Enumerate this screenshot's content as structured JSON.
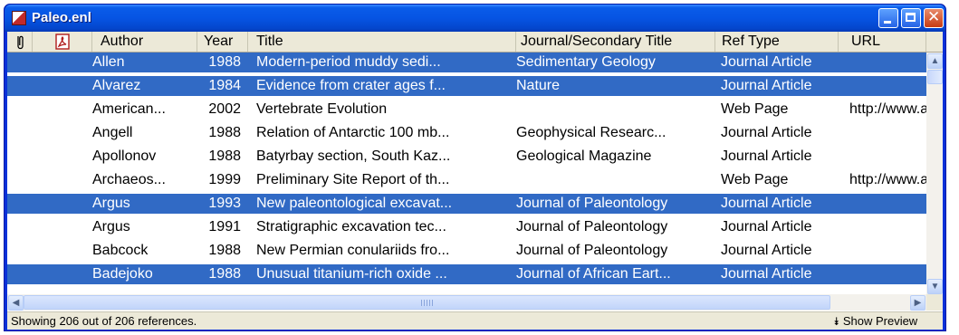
{
  "window": {
    "title": "Paleo.enl"
  },
  "columns": {
    "attachment_icon": "paperclip-icon",
    "pdf_icon": "pdf-icon",
    "author": "Author",
    "year": "Year",
    "title": "Title",
    "journal": "Journal/Secondary Title",
    "reftype": "Ref Type",
    "url": "URL"
  },
  "rows": [
    {
      "selected": true,
      "author": "Allen",
      "year": "1988",
      "title": "Modern-period muddy sedi...",
      "journal": "Sedimentary Geology",
      "reftype": "Journal Article",
      "url": ""
    },
    {
      "selected": true,
      "author": "Alvarez",
      "year": "1984",
      "title": "Evidence from crater ages f...",
      "journal": "Nature",
      "reftype": "Journal Article",
      "url": ""
    },
    {
      "selected": false,
      "author": "American...",
      "year": "2002",
      "title": "Vertebrate Evolution",
      "journal": "",
      "reftype": "Web Page",
      "url": "http://www.a"
    },
    {
      "selected": false,
      "author": "Angell",
      "year": "1988",
      "title": "Relation of Antarctic 100 mb...",
      "journal": "Geophysical Researc...",
      "reftype": "Journal Article",
      "url": ""
    },
    {
      "selected": false,
      "author": "Apollonov",
      "year": "1988",
      "title": "Batyrbay section, South Kaz...",
      "journal": "Geological Magazine",
      "reftype": "Journal Article",
      "url": ""
    },
    {
      "selected": false,
      "author": "Archaeos...",
      "year": "1999",
      "title": "Preliminary Site Report of th...",
      "journal": "",
      "reftype": "Web Page",
      "url": "http://www.a"
    },
    {
      "selected": true,
      "author": "Argus",
      "year": "1993",
      "title": "New paleontological excavat...",
      "journal": "Journal of Paleontology",
      "reftype": "Journal Article",
      "url": ""
    },
    {
      "selected": false,
      "author": "Argus",
      "year": "1991",
      "title": "Stratigraphic excavation tec...",
      "journal": "Journal of Paleontology",
      "reftype": "Journal Article",
      "url": ""
    },
    {
      "selected": false,
      "author": "Babcock",
      "year": "1988",
      "title": "New Permian conulariids fro...",
      "journal": "Journal of Paleontology",
      "reftype": "Journal Article",
      "url": ""
    },
    {
      "selected": true,
      "author": "Badejoko",
      "year": "1988",
      "title": "Unusual titanium-rich oxide ...",
      "journal": "Journal of African Eart...",
      "reftype": "Journal Article",
      "url": ""
    }
  ],
  "status": {
    "text": "Showing 206 out of 206 references.",
    "preview_label": "Show Preview"
  },
  "colors": {
    "selection": "#316ac5",
    "titlebar": "#0654e3"
  }
}
